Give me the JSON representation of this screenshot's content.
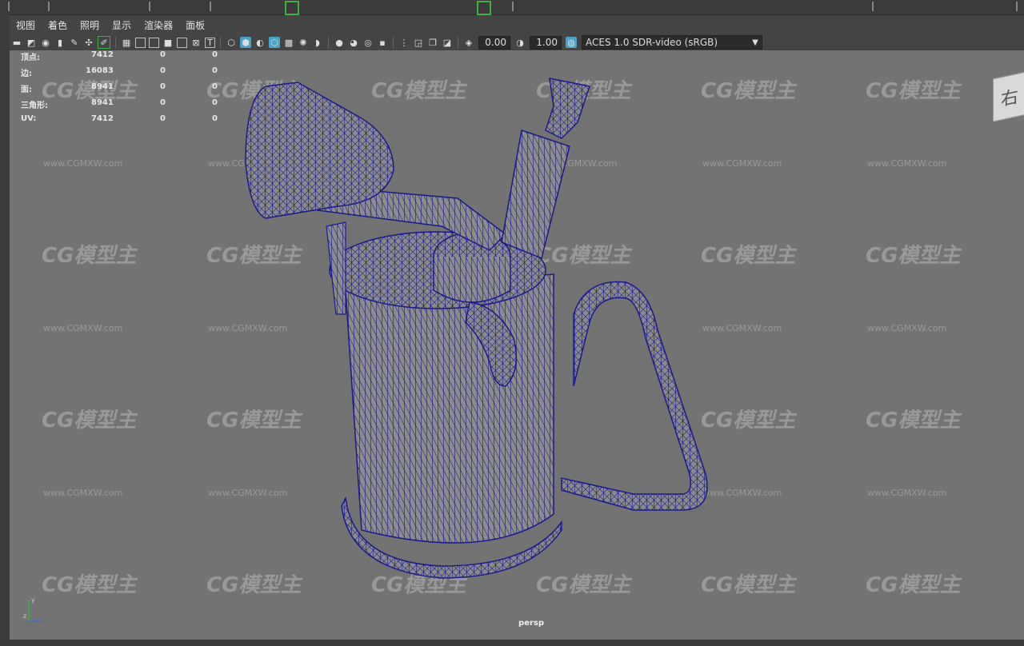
{
  "menubar": {
    "items": [
      "视图",
      "着色",
      "照明",
      "显示",
      "渲染器",
      "面板"
    ]
  },
  "toolbar": {
    "exposure_value": "0.00",
    "gamma_value": "1.00",
    "color_space": "ACES 1.0 SDR-video (sRGB)",
    "icons": [
      "camera-select-icon",
      "camera-attributes-icon",
      "bookmark-icon",
      "image-plane-icon",
      "grease-pencil-icon",
      "2d-pan-zoom-icon",
      "grid-icon",
      "film-gate-icon",
      "resolution-gate-icon",
      "gate-mask-icon",
      "field-chart-icon",
      "safe-action-icon",
      "safe-title-icon",
      "wireframe-icon",
      "smooth-shade-icon",
      "default-material-icon",
      "wireframe-on-shaded-icon",
      "xray-icon",
      "use-all-lights-icon",
      "shadows-icon",
      "ambient-occlusion-icon",
      "motion-blur-icon",
      "anti-aliasing-icon",
      "isolate-select-icon",
      "xray-joints-icon",
      "xray-active-icon",
      "exposure-icon",
      "gamma-icon",
      "color-management-icon"
    ]
  },
  "hud": {
    "rows": [
      {
        "label": "顶点:",
        "value": "7412",
        "sel1": "0",
        "sel2": "0"
      },
      {
        "label": "边:",
        "value": "16083",
        "sel1": "0",
        "sel2": "0"
      },
      {
        "label": "面:",
        "value": "8941",
        "sel1": "0",
        "sel2": "0"
      },
      {
        "label": "三角形:",
        "value": "8941",
        "sel1": "0",
        "sel2": "0"
      },
      {
        "label": "UV:",
        "value": "7412",
        "sel1": "0",
        "sel2": "0"
      }
    ]
  },
  "viewport": {
    "camera_label": "persp",
    "viewcube_face": "右",
    "axis_y": "y",
    "axis_z": "z"
  },
  "watermark": {
    "logo": "CG模型主",
    "url": "www.CGMXW.com"
  },
  "colors": {
    "viewport_bg": "#737373",
    "wireframe": "#1a1a8c",
    "mesh_fill": "#8a8a8a"
  }
}
